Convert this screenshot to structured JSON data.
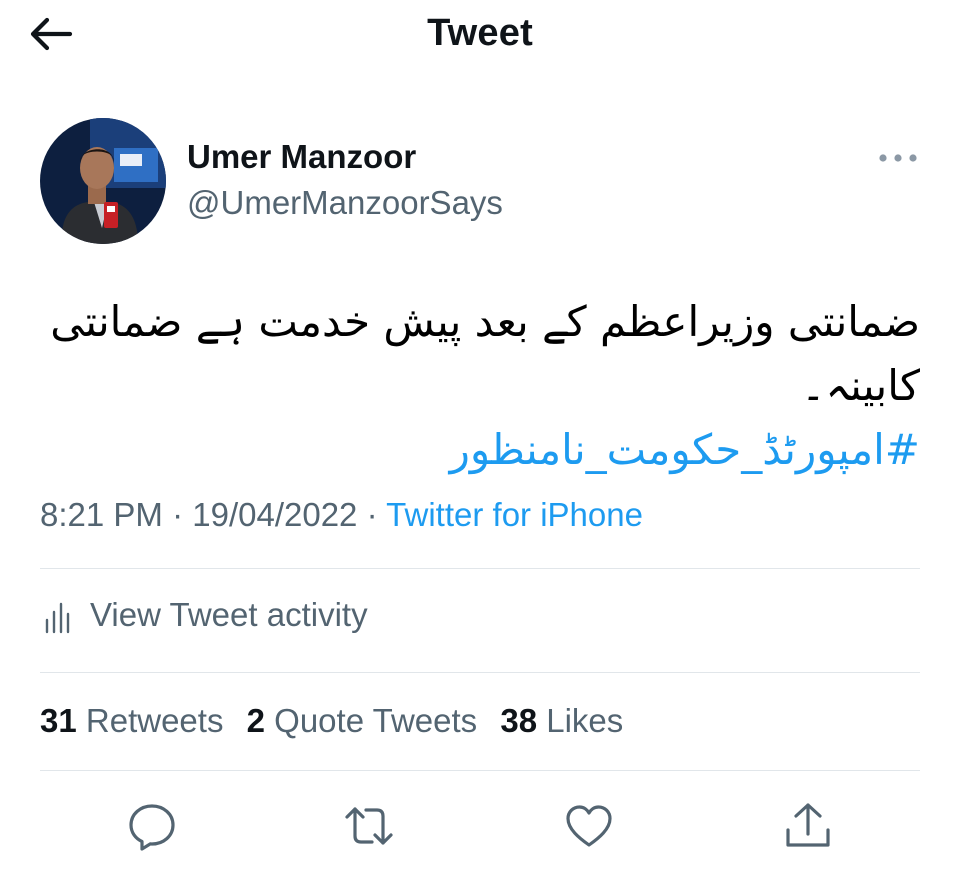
{
  "header": {
    "title": "Tweet",
    "back_icon": "arrow-left-icon"
  },
  "author": {
    "display_name": "Umer Manzoor",
    "handle": "@UmerManzoorSays"
  },
  "tweet": {
    "text": "ضمانتی وزیراعظم کے بعد پیش خدمت ہے ضمانتی کابینہ۔",
    "hashtag": "#امپورٹڈ_حکومت_نامنظور",
    "time": "8:21 PM",
    "date": "19/04/2022",
    "separator": "·",
    "source": "Twitter for iPhone"
  },
  "activity": {
    "label": "View Tweet activity",
    "icon": "bar-chart-icon"
  },
  "stats": [
    {
      "count": "31",
      "label": "Retweets"
    },
    {
      "count": "2",
      "label": "Quote Tweets"
    },
    {
      "count": "38",
      "label": "Likes"
    }
  ],
  "actions": [
    "reply-icon",
    "retweet-icon",
    "like-icon",
    "share-icon"
  ],
  "colors": {
    "accent": "#1d9bf0",
    "secondary_text": "#536471",
    "primary_text": "#0f1419",
    "divider": "#e1e6ea"
  }
}
